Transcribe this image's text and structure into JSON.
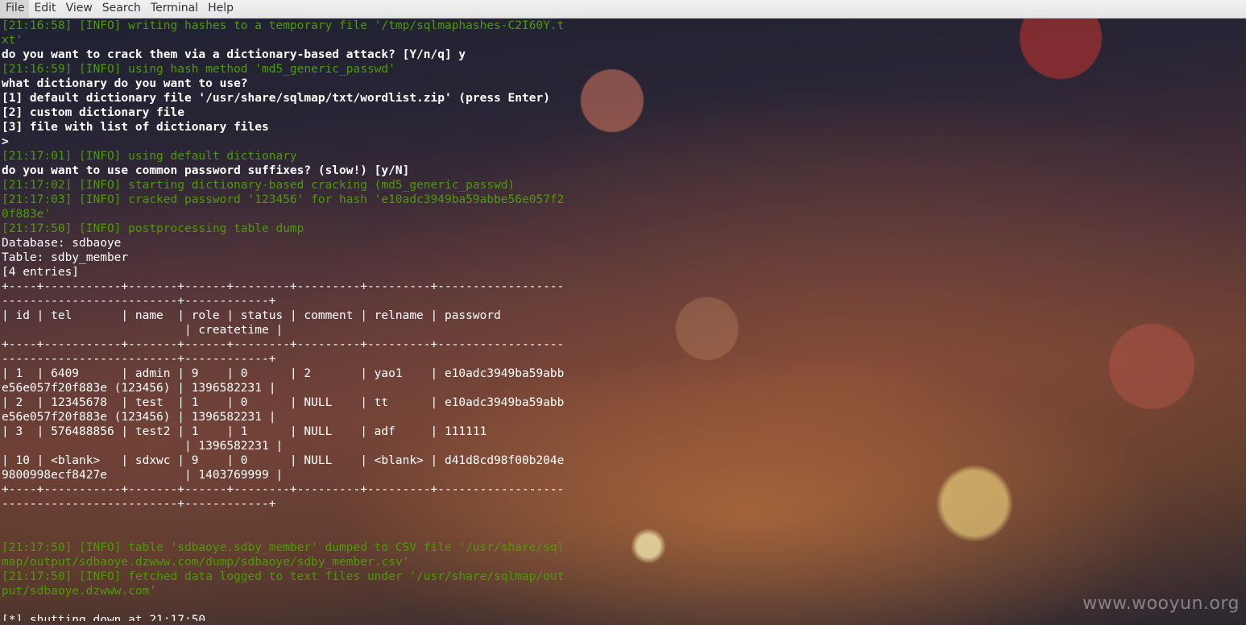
{
  "menubar": {
    "items": [
      "File",
      "Edit",
      "View",
      "Search",
      "Terminal",
      "Help"
    ]
  },
  "terminal": {
    "lines": [
      {
        "type": "info",
        "text": "[21:16:58] [INFO] writing hashes to a temporary file '/tmp/sqlmaphashes-C2I60Y.t"
      },
      {
        "type": "info",
        "text": "xt'"
      },
      {
        "type": "prompt",
        "text": "do you want to crack them via a dictionary-based attack? [Y/n/q] y"
      },
      {
        "type": "info",
        "text": "[21:16:59] [INFO] using hash method 'md5_generic_passwd'"
      },
      {
        "type": "prompt",
        "text": "what dictionary do you want to use?"
      },
      {
        "type": "prompt",
        "text": "[1] default dictionary file '/usr/share/sqlmap/txt/wordlist.zip' (press Enter)"
      },
      {
        "type": "prompt",
        "text": "[2] custom dictionary file"
      },
      {
        "type": "prompt",
        "text": "[3] file with list of dictionary files"
      },
      {
        "type": "prompt",
        "text": ">"
      },
      {
        "type": "info",
        "text": "[21:17:01] [INFO] using default dictionary"
      },
      {
        "type": "prompt",
        "text": "do you want to use common password suffixes? (slow!) [y/N]"
      },
      {
        "type": "info",
        "text": "[21:17:02] [INFO] starting dictionary-based cracking (md5_generic_passwd)"
      },
      {
        "type": "info",
        "text": "[21:17:03] [INFO] cracked password '123456' for hash 'e10adc3949ba59abbe56e057f2"
      },
      {
        "type": "info",
        "text": "0f883e'"
      },
      {
        "type": "info",
        "text": "[21:17:50] [INFO] postprocessing table dump"
      },
      {
        "type": "plain",
        "text": "Database: sdbaoye"
      },
      {
        "type": "plain",
        "text": "Table: sdby_member"
      },
      {
        "type": "plain",
        "text": "[4 entries]"
      },
      {
        "type": "plain",
        "text": "+----+-----------+-------+------+--------+---------+---------+------------------"
      },
      {
        "type": "plain",
        "text": "-------------------------+------------+"
      },
      {
        "type": "plain",
        "text": "| id | tel       | name  | role | status | comment | relname | password"
      },
      {
        "type": "plain",
        "text": "                          | createtime |"
      },
      {
        "type": "plain",
        "text": "+----+-----------+-------+------+--------+---------+---------+------------------"
      },
      {
        "type": "plain",
        "text": "-------------------------+------------+"
      },
      {
        "type": "plain",
        "text": "| 1  | 6409      | admin | 9    | 0      | 2       | yao1    | e10adc3949ba59abb"
      },
      {
        "type": "plain",
        "text": "e56e057f20f883e (123456) | 1396582231 |"
      },
      {
        "type": "plain",
        "text": "| 2  | 12345678  | test  | 1    | 0      | NULL    | tt      | e10adc3949ba59abb"
      },
      {
        "type": "plain",
        "text": "e56e057f20f883e (123456) | 1396582231 |"
      },
      {
        "type": "plain",
        "text": "| 3  | 576488856 | test2 | 1    | 1      | NULL    | adf     | 111111"
      },
      {
        "type": "plain",
        "text": "                          | 1396582231 |"
      },
      {
        "type": "plain",
        "text": "| 10 | <blank>   | sdxwc | 9    | 0      | NULL    | <blank> | d41d8cd98f00b204e"
      },
      {
        "type": "plain",
        "text": "9800998ecf8427e           | 1403769999 |"
      },
      {
        "type": "plain",
        "text": "+----+-----------+-------+------+--------+---------+---------+------------------"
      },
      {
        "type": "plain",
        "text": "-------------------------+------------+"
      },
      {
        "type": "plain",
        "text": ""
      },
      {
        "type": "plain",
        "text": ""
      },
      {
        "type": "info",
        "text": "[21:17:50] [INFO] table 'sdbaoye.sdby_member' dumped to CSV file '/usr/share/sql"
      },
      {
        "type": "info",
        "text": "map/output/sdbaoye.dzwww.com/dump/sdbaoye/sdby_member.csv'"
      },
      {
        "type": "info",
        "text": "[21:17:50] [INFO] fetched data logged to text files under '/usr/share/sqlmap/out"
      },
      {
        "type": "info",
        "text": "put/sdbaoye.dzwww.com'"
      },
      {
        "type": "plain",
        "text": ""
      },
      {
        "type": "plain",
        "text": "[*] shutting down at 21:17:50"
      }
    ]
  },
  "watermark": "www.wooyun.org",
  "colors": {
    "info": "#4e9a06",
    "text": "#ffffff",
    "menubar_bg": "#ececec"
  }
}
